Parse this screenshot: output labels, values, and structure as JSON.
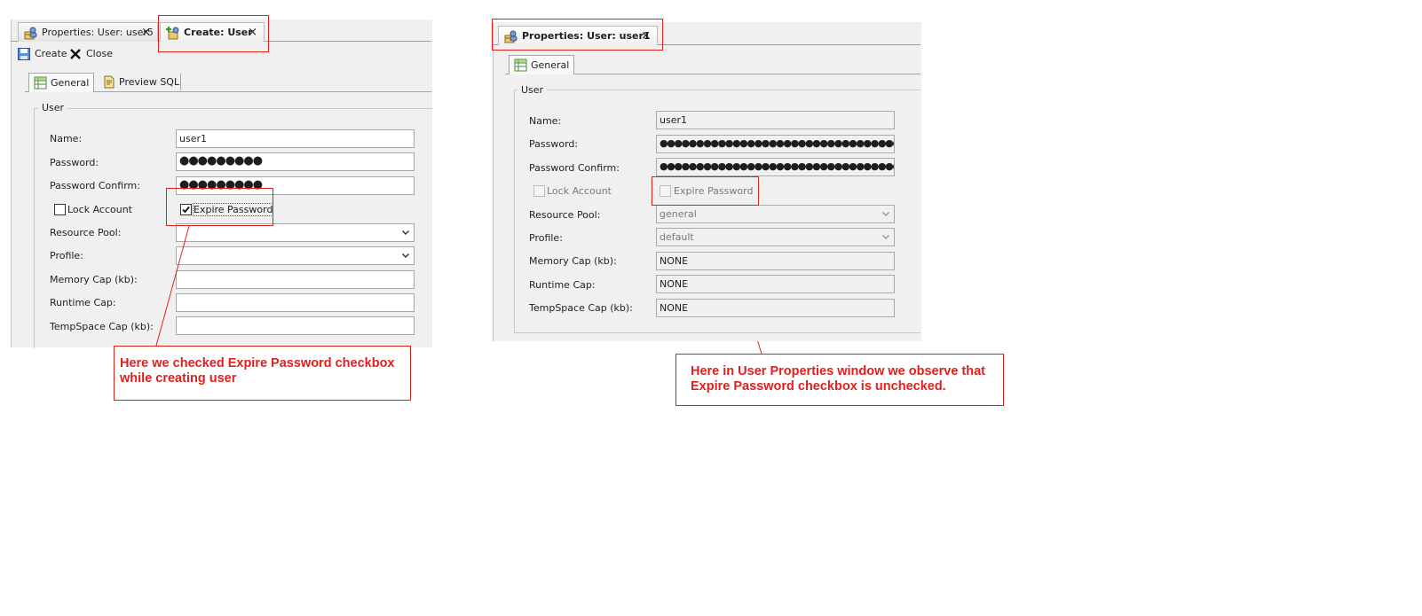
{
  "left": {
    "tabs": [
      {
        "label": "Properties: User: user5",
        "close": "×"
      },
      {
        "label": "Create: User",
        "close": "×"
      }
    ],
    "toolbar": {
      "create_label": "Create",
      "close_label": "Close"
    },
    "inner_tabs": [
      "General",
      "Preview SQL"
    ],
    "group_label": "User",
    "labels": {
      "name": "Name:",
      "password": "Password:",
      "password_confirm": "Password Confirm:",
      "lock_account": "Lock Account",
      "expire_password": "Expire Password",
      "resource_pool": "Resource Pool:",
      "profile": "Profile:",
      "memory_cap": "Memory Cap (kb):",
      "runtime_cap": "Runtime Cap:",
      "tempspace_cap": "TempSpace Cap (kb):"
    },
    "values": {
      "name": "user1",
      "password": "●●●●●●●●●",
      "password_confirm": "●●●●●●●●●",
      "lock_account_checked": false,
      "expire_password_checked": true,
      "resource_pool": "",
      "profile": "",
      "memory_cap": "",
      "runtime_cap": "",
      "tempspace_cap": ""
    },
    "callout_lines": [
      "Here we checked Expire Password checkbox",
      "while creating user"
    ]
  },
  "right": {
    "tabs": [
      {
        "label": "Properties: User: user1",
        "close": "×"
      }
    ],
    "inner_tabs": [
      "General"
    ],
    "group_label": "User",
    "labels": {
      "name": "Name:",
      "password": "Password:",
      "password_confirm": "Password Confirm:",
      "lock_account": "Lock Account",
      "expire_password": "Expire Password",
      "resource_pool": "Resource Pool:",
      "profile": "Profile:",
      "memory_cap": "Memory Cap (kb):",
      "runtime_cap": "Runtime Cap:",
      "tempspace_cap": "TempSpace Cap (kb):"
    },
    "values": {
      "name": "user1",
      "password": "●●●●●●●●●●●●●●●●●●●●●●●●●●●●●●●●●",
      "password_confirm": "●●●●●●●●●●●●●●●●●●●●●●●●●●●●●●●●●",
      "lock_account_checked": false,
      "expire_password_checked": false,
      "resource_pool": "general",
      "profile": "default",
      "memory_cap": "NONE",
      "runtime_cap": "NONE",
      "tempspace_cap": "NONE"
    },
    "callout_lines": [
      "Here in User Properties window we observe that",
      "Expire Password checkbox is unchecked."
    ]
  },
  "colors": {
    "annotation_red": "#e0201c",
    "panel_bg": "#f0f0f0"
  }
}
